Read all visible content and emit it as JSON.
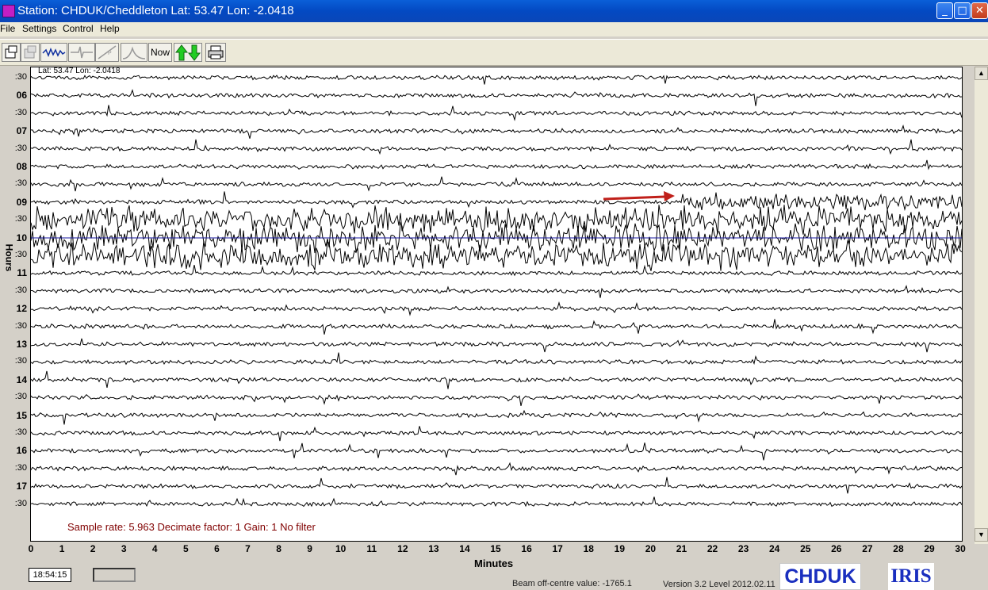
{
  "window": {
    "title": "Station: CHDUK/Cheddleton Lat: 53.47 Lon: -2.0418"
  },
  "menu": [
    "File",
    "Settings",
    "Control",
    "Help"
  ],
  "toolbar": {
    "now_label": "Now"
  },
  "plot": {
    "latlon": "Lat: 53.47 Lon: -2.0418",
    "info": "Sample rate: 5.963  Decimate factor: 1  Gain: 1  No filter",
    "x_axis_label": "Minutes",
    "y_axis_label": "Hours",
    "x_ticks": [
      "0",
      "1",
      "2",
      "3",
      "4",
      "5",
      "6",
      "7",
      "8",
      "9",
      "10",
      "11",
      "12",
      "13",
      "14",
      "15",
      "16",
      "17",
      "18",
      "19",
      "20",
      "21",
      "22",
      "23",
      "24",
      "25",
      "26",
      "27",
      "28",
      "29",
      "30"
    ],
    "rows": [
      ":30",
      "06",
      ":30",
      "07",
      ":30",
      "08",
      ":30",
      "09",
      ":30",
      "10",
      ":30",
      "11",
      ":30",
      "12",
      ":30",
      "13",
      ":30",
      "14",
      ":30",
      "15",
      ":30",
      "16",
      ":30",
      "17",
      ":30"
    ]
  },
  "status": {
    "clock": "18:54:15",
    "beam": "Beam off-centre value: -1765.1",
    "version": "Version 3.2 Level 2012.02.11"
  },
  "logos": {
    "station": "CHDUK",
    "iris": "IRIS"
  },
  "colors": {
    "trace": "#000000",
    "arrow": "#c0201a",
    "midline": "#1a1aa0",
    "info_text": "#800000"
  }
}
